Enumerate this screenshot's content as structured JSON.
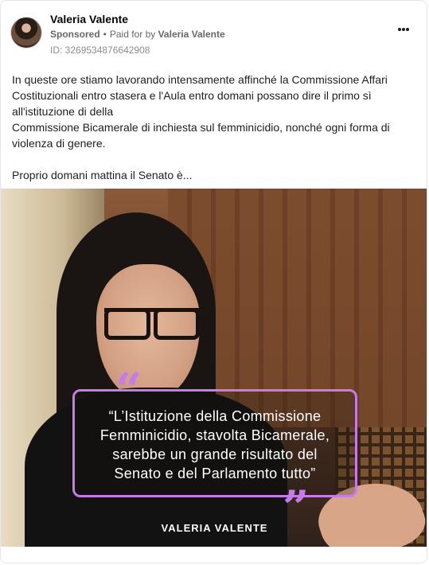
{
  "post": {
    "author": "Valeria Valente",
    "sponsored_label": "Sponsored",
    "paid_for_prefix": "Paid for by",
    "paid_for_name": "Valeria Valente",
    "ad_id": "ID: 3269534876642908",
    "body_lines": [
      "In queste ore stiamo lavorando intensamente affinché la Commissione Affari",
      "Costituzionali entro stasera e l'Aula entro domani possano dire il primo sì",
      "all'istituzione di della",
      "Commissione Bicamerale di inchiesta sul femminicidio, nonché ogni forma di",
      "violenza di genere."
    ],
    "body_truncated": "Proprio domani mattina il Senato è..."
  },
  "media": {
    "quote_lines": [
      "“L’Istituzione della Commissione",
      "Femminicidio, stavolta Bicamerale,",
      "sarebbe un grande risultato del",
      "Senato e del Parlamento tutto”"
    ],
    "signature": "VALERIA VALENTE",
    "quote_open_glyph": "“",
    "quote_close_glyph": "”",
    "accent_color": "#c77be8"
  },
  "icons": {
    "more": "more-options-icon"
  }
}
